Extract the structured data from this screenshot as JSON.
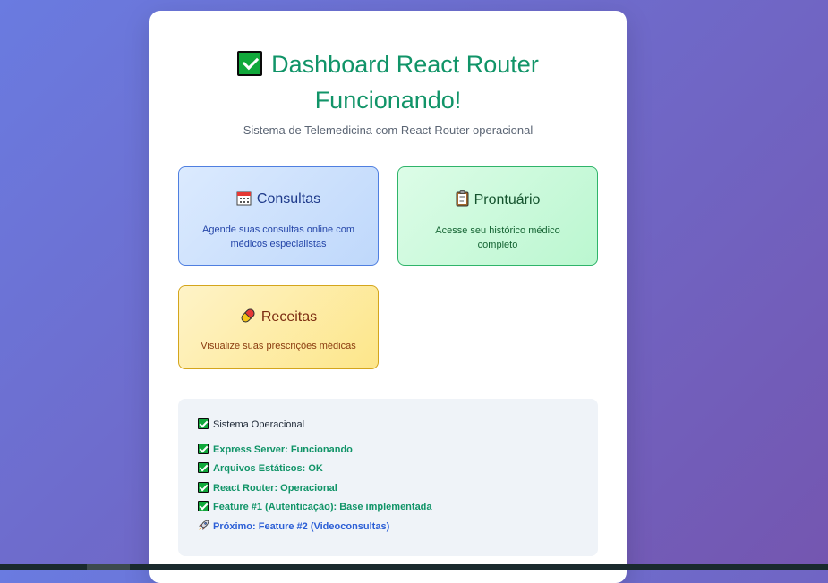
{
  "header": {
    "title_line1": "Dashboard React Router",
    "title_line2": "Funcionando!",
    "title_icon": "check-box-icon",
    "subtitle": "Sistema de Telemedicina com React Router operacional"
  },
  "features": [
    {
      "title": "Consultas",
      "icon": "calendar-icon",
      "description": "Agende suas consultas online com médicos especialistas"
    },
    {
      "title": "Prontuário",
      "icon": "clipboard-icon",
      "description": "Acesse seu histórico médico completo"
    },
    {
      "title": "Receitas",
      "icon": "pill-icon",
      "description": "Visualize suas prescrições médicas"
    }
  ],
  "status": {
    "heading": "Sistema Operacional",
    "items": [
      {
        "text": "Express Server: Funcionando",
        "icon": "check-icon"
      },
      {
        "text": "Arquivos Estáticos: OK",
        "icon": "check-icon"
      },
      {
        "text": "React Router: Operacional",
        "icon": "check-icon"
      },
      {
        "text": "Feature #1 (Autenticação): Base implementada",
        "icon": "check-icon"
      },
      {
        "text": "Próximo: Feature #2 (Videoconsultas)",
        "icon": "rocket-icon"
      }
    ]
  },
  "colors": {
    "accent_green": "#119468",
    "next_blue": "#2c5fd6",
    "background_start": "#6a7be0",
    "background_end": "#7456b0"
  }
}
